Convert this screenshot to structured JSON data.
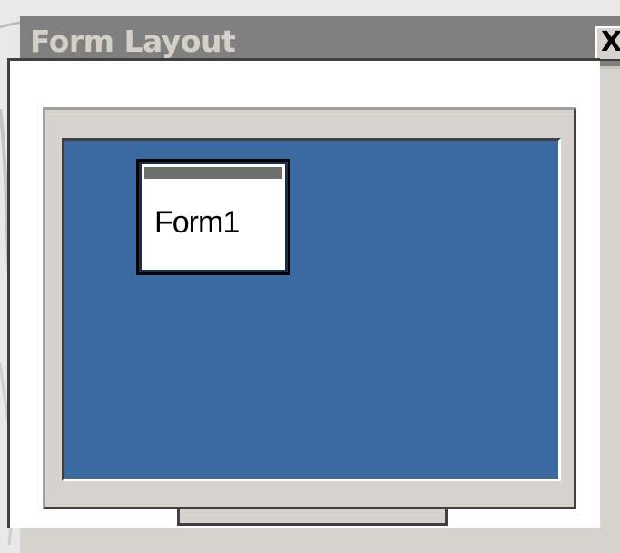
{
  "window": {
    "title": "Form Layout",
    "close_label": "X"
  },
  "form_thumbnail": {
    "caption": "Form1"
  },
  "colors": {
    "title_bar": "#808080",
    "title_text": "#d4d0c8",
    "screen": "#3a6aa0",
    "face": "#d6d3ce"
  },
  "icons": {
    "close": "close-icon"
  }
}
